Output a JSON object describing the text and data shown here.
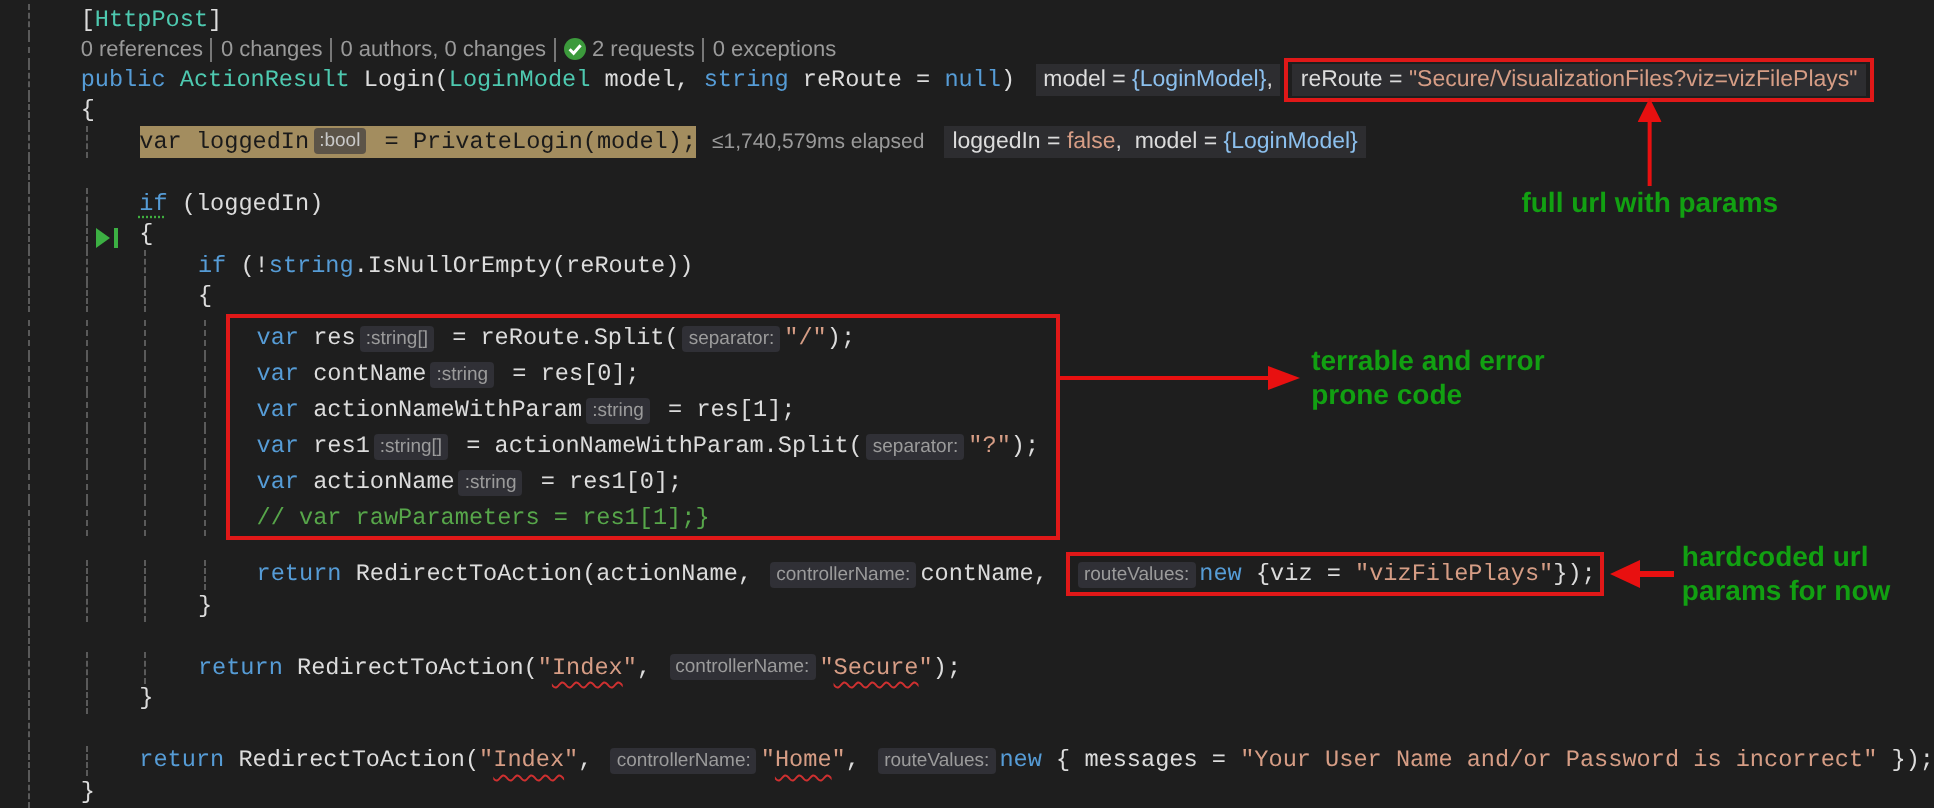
{
  "lines": [
    {
      "kind": "code",
      "current": false,
      "tokens": [
        {
          "kind": "plain",
          "text": "    ["
        },
        {
          "kind": "type",
          "text": "HttpPost"
        },
        {
          "kind": "plain",
          "text": "]"
        }
      ]
    },
    {
      "kind": "codelens",
      "items": [
        {
          "text": "0 references",
          "passed": false
        },
        {
          "text": "0 changes",
          "passed": false
        },
        {
          "text": "0 authors, 0 changes",
          "passed": false
        },
        {
          "text": "2 requests",
          "passed": true
        },
        {
          "text": "0 exceptions",
          "passed": false
        }
      ]
    },
    {
      "kind": "code",
      "current": false,
      "tokens": [
        {
          "kind": "kw",
          "text": "    public "
        },
        {
          "kind": "type",
          "text": "ActionResult"
        },
        {
          "kind": "plain",
          "text": " Login("
        },
        {
          "kind": "type",
          "text": "LoginModel"
        },
        {
          "kind": "plain",
          "text": " model, "
        },
        {
          "kind": "kw",
          "text": "string"
        },
        {
          "kind": "plain",
          "text": " reRoute = "
        },
        {
          "kind": "kw",
          "text": "null"
        },
        {
          "kind": "plain",
          "text": ")"
        },
        {
          "kind": "tip",
          "parts": [
            {
              "kind": "name",
              "text": "model = "
            },
            {
              "kind": "obj",
              "text": "{LoginModel}"
            },
            {
              "kind": "name",
              "text": ","
            }
          ]
        },
        {
          "kind": "box",
          "annotation": {
            "kind": "below",
            "text": "full url with params"
          },
          "tokens": [
            {
              "kind": "tip",
              "parts": [
                {
                  "kind": "name",
                  "text": "reRoute = "
                },
                {
                  "kind": "str",
                  "text": "\"Secure/VisualizationFiles?viz=vizFilePlays\""
                }
              ]
            }
          ]
        }
      ]
    },
    {
      "kind": "code",
      "current": false,
      "tokens": [
        {
          "kind": "plain",
          "text": "    {"
        }
      ]
    },
    {
      "kind": "code",
      "current": true,
      "tokens": [
        {
          "kind": "kw",
          "text": "        var"
        },
        {
          "kind": "plain",
          "text": " loggedIn"
        },
        {
          "kind": "hint",
          "text": ":bool"
        },
        {
          "kind": "plain",
          "text": " = PrivateLogin(model);"
        },
        {
          "kind": "perf",
          "text": "≤1,740,579ms elapsed"
        },
        {
          "kind": "tip",
          "parts": [
            {
              "kind": "name",
              "text": "loggedIn = "
            },
            {
              "kind": "str",
              "text": "false"
            },
            {
              "kind": "name",
              "text": ",  model = "
            },
            {
              "kind": "obj",
              "text": "{LoginModel}"
            }
          ]
        }
      ]
    },
    {
      "kind": "blank"
    },
    {
      "kind": "code",
      "current": false,
      "tokens": [
        {
          "kind": "kw",
          "text": "        if",
          "suggestion": true
        },
        {
          "kind": "plain",
          "text": " (loggedIn)"
        }
      ]
    },
    {
      "kind": "code",
      "current": false,
      "run_to_click": true,
      "tokens": [
        {
          "kind": "plain",
          "text": "        {"
        }
      ]
    },
    {
      "kind": "code",
      "current": false,
      "tokens": [
        {
          "kind": "kw",
          "text": "            if"
        },
        {
          "kind": "plain",
          "text": " (!"
        },
        {
          "kind": "kw",
          "text": "string"
        },
        {
          "kind": "plain",
          "text": ".IsNullOrEmpty(reRoute))"
        }
      ]
    },
    {
      "kind": "code",
      "current": false,
      "tokens": [
        {
          "kind": "plain",
          "text": "            {"
        }
      ]
    },
    {
      "kind": "block",
      "annotation": {
        "kind": "right",
        "text": "terrable and error\nprone code"
      },
      "lines": [
        {
          "kind": "code",
          "current": false,
          "tokens": [
            {
              "kind": "kw",
              "text": "                var"
            },
            {
              "kind": "plain",
              "text": " res"
            },
            {
              "kind": "hint",
              "text": ":string[]"
            },
            {
              "kind": "plain",
              "text": " = reRoute.Split("
            },
            {
              "kind": "hint",
              "text": "separator:"
            },
            {
              "kind": "str",
              "text": "\"/\""
            },
            {
              "kind": "plain",
              "text": ");"
            }
          ]
        },
        {
          "kind": "code",
          "current": false,
          "tokens": [
            {
              "kind": "kw",
              "text": "                var"
            },
            {
              "kind": "plain",
              "text": " contName"
            },
            {
              "kind": "hint",
              "text": ":string"
            },
            {
              "kind": "plain",
              "text": " = res[0];"
            }
          ]
        },
        {
          "kind": "code",
          "current": false,
          "tokens": [
            {
              "kind": "kw",
              "text": "                var"
            },
            {
              "kind": "plain",
              "text": " actionNameWithParam"
            },
            {
              "kind": "hint",
              "text": ":string"
            },
            {
              "kind": "plain",
              "text": " = res[1];"
            }
          ]
        },
        {
          "kind": "code",
          "current": false,
          "tokens": [
            {
              "kind": "kw",
              "text": "                var"
            },
            {
              "kind": "plain",
              "text": " res1"
            },
            {
              "kind": "hint",
              "text": ":string[]"
            },
            {
              "kind": "plain",
              "text": " = actionNameWithParam.Split("
            },
            {
              "kind": "hint",
              "text": "separator:"
            },
            {
              "kind": "str",
              "text": "\"?\""
            },
            {
              "kind": "plain",
              "text": ");"
            }
          ]
        },
        {
          "kind": "code",
          "current": false,
          "tokens": [
            {
              "kind": "kw",
              "text": "                var"
            },
            {
              "kind": "plain",
              "text": " actionName"
            },
            {
              "kind": "hint",
              "text": ":string"
            },
            {
              "kind": "plain",
              "text": " = res1[0];"
            }
          ]
        },
        {
          "kind": "code",
          "current": false,
          "tokens": [
            {
              "kind": "comment",
              "text": "                // var rawParameters = res1[1];}"
            }
          ]
        }
      ]
    },
    {
      "kind": "blank"
    },
    {
      "kind": "code",
      "current": false,
      "tokens": [
        {
          "kind": "kw",
          "text": "                return"
        },
        {
          "kind": "plain",
          "text": " RedirectToAction(actionName, "
        },
        {
          "kind": "hint",
          "text": "controllerName:"
        },
        {
          "kind": "plain",
          "text": "contName, "
        },
        {
          "kind": "box",
          "annotation": {
            "kind": "left",
            "text": "hardcoded url\nparams for now"
          },
          "tokens": [
            {
              "kind": "hint",
              "text": "routeValues:"
            },
            {
              "kind": "kw",
              "text": "new"
            },
            {
              "kind": "plain",
              "text": " {viz = "
            },
            {
              "kind": "str",
              "text": "\"vizFilePlays\""
            },
            {
              "kind": "plain",
              "text": "});"
            }
          ]
        }
      ]
    },
    {
      "kind": "code",
      "current": false,
      "tokens": [
        {
          "kind": "plain",
          "text": "            }"
        }
      ]
    },
    {
      "kind": "blank"
    },
    {
      "kind": "code",
      "current": false,
      "tokens": [
        {
          "kind": "kw",
          "text": "            return"
        },
        {
          "kind": "plain",
          "text": " RedirectToAction("
        },
        {
          "kind": "str",
          "text": "\""
        },
        {
          "kind": "str",
          "text": "Index",
          "spelling_error": true
        },
        {
          "kind": "str",
          "text": "\""
        },
        {
          "kind": "plain",
          "text": ", "
        },
        {
          "kind": "hint",
          "text": "controllerName:"
        },
        {
          "kind": "str",
          "text": "\""
        },
        {
          "kind": "str",
          "text": "Secure",
          "spelling_error": true
        },
        {
          "kind": "str",
          "text": "\""
        },
        {
          "kind": "plain",
          "text": ");"
        }
      ]
    },
    {
      "kind": "code",
      "current": false,
      "tokens": [
        {
          "kind": "plain",
          "text": "        }"
        }
      ]
    },
    {
      "kind": "blank"
    },
    {
      "kind": "code",
      "current": false,
      "tokens": [
        {
          "kind": "kw",
          "text": "        return"
        },
        {
          "kind": "plain",
          "text": " RedirectToAction("
        },
        {
          "kind": "str",
          "text": "\""
        },
        {
          "kind": "str",
          "text": "Index",
          "spelling_error": true
        },
        {
          "kind": "str",
          "text": "\""
        },
        {
          "kind": "plain",
          "text": ", "
        },
        {
          "kind": "hint",
          "text": "controllerName:"
        },
        {
          "kind": "str",
          "text": "\""
        },
        {
          "kind": "str",
          "text": "Home",
          "spelling_error": true
        },
        {
          "kind": "str",
          "text": "\""
        },
        {
          "kind": "plain",
          "text": ", "
        },
        {
          "kind": "hint",
          "text": "routeValues:"
        },
        {
          "kind": "kw",
          "text": "new"
        },
        {
          "kind": "plain",
          "text": " { messages = "
        },
        {
          "kind": "str",
          "text": "\"Your User Name and/or Password is incorrect\""
        },
        {
          "kind": "plain",
          "text": " });"
        }
      ]
    },
    {
      "kind": "code",
      "current": false,
      "tokens": [
        {
          "kind": "plain",
          "text": "    }"
        }
      ]
    }
  ]
}
